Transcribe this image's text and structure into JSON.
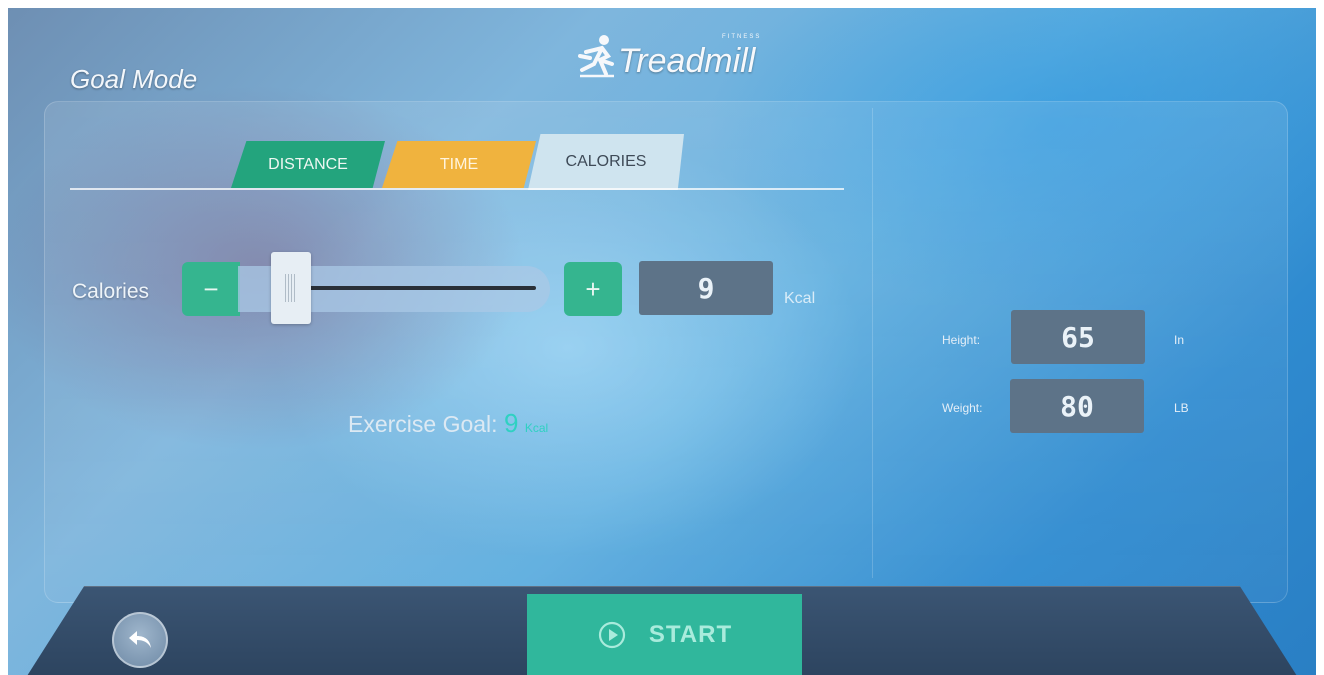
{
  "header": {
    "title": "Goal Mode",
    "logo_text": "Treadmill",
    "logo_small": "FITNESS"
  },
  "tabs": [
    {
      "label": "DISTANCE",
      "color": "#23a47d",
      "active": false
    },
    {
      "label": "TIME",
      "color": "#f0b33e",
      "active": false
    },
    {
      "label": "CALORIES",
      "color": "#cfe4ef",
      "active": true
    }
  ],
  "calories": {
    "label": "Calories",
    "minus_label": "−",
    "plus_label": "+",
    "value": "9",
    "unit": "Kcal",
    "slider_level": 0.05
  },
  "goal": {
    "label": "Exercise Goal:",
    "value": "9",
    "unit": "Kcal"
  },
  "profile": {
    "height": {
      "label": "Height:",
      "value": "65",
      "unit": "In"
    },
    "weight": {
      "label": "Weight:",
      "value": "80",
      "unit": "LB"
    }
  },
  "footer": {
    "start_label": "START",
    "back_icon": "back-arrow-icon",
    "start_icon": "play-circle-icon"
  },
  "colors": {
    "accent_green": "#35b58f",
    "start_green": "#30b79c",
    "goal_cyan": "#2fd1c2"
  }
}
